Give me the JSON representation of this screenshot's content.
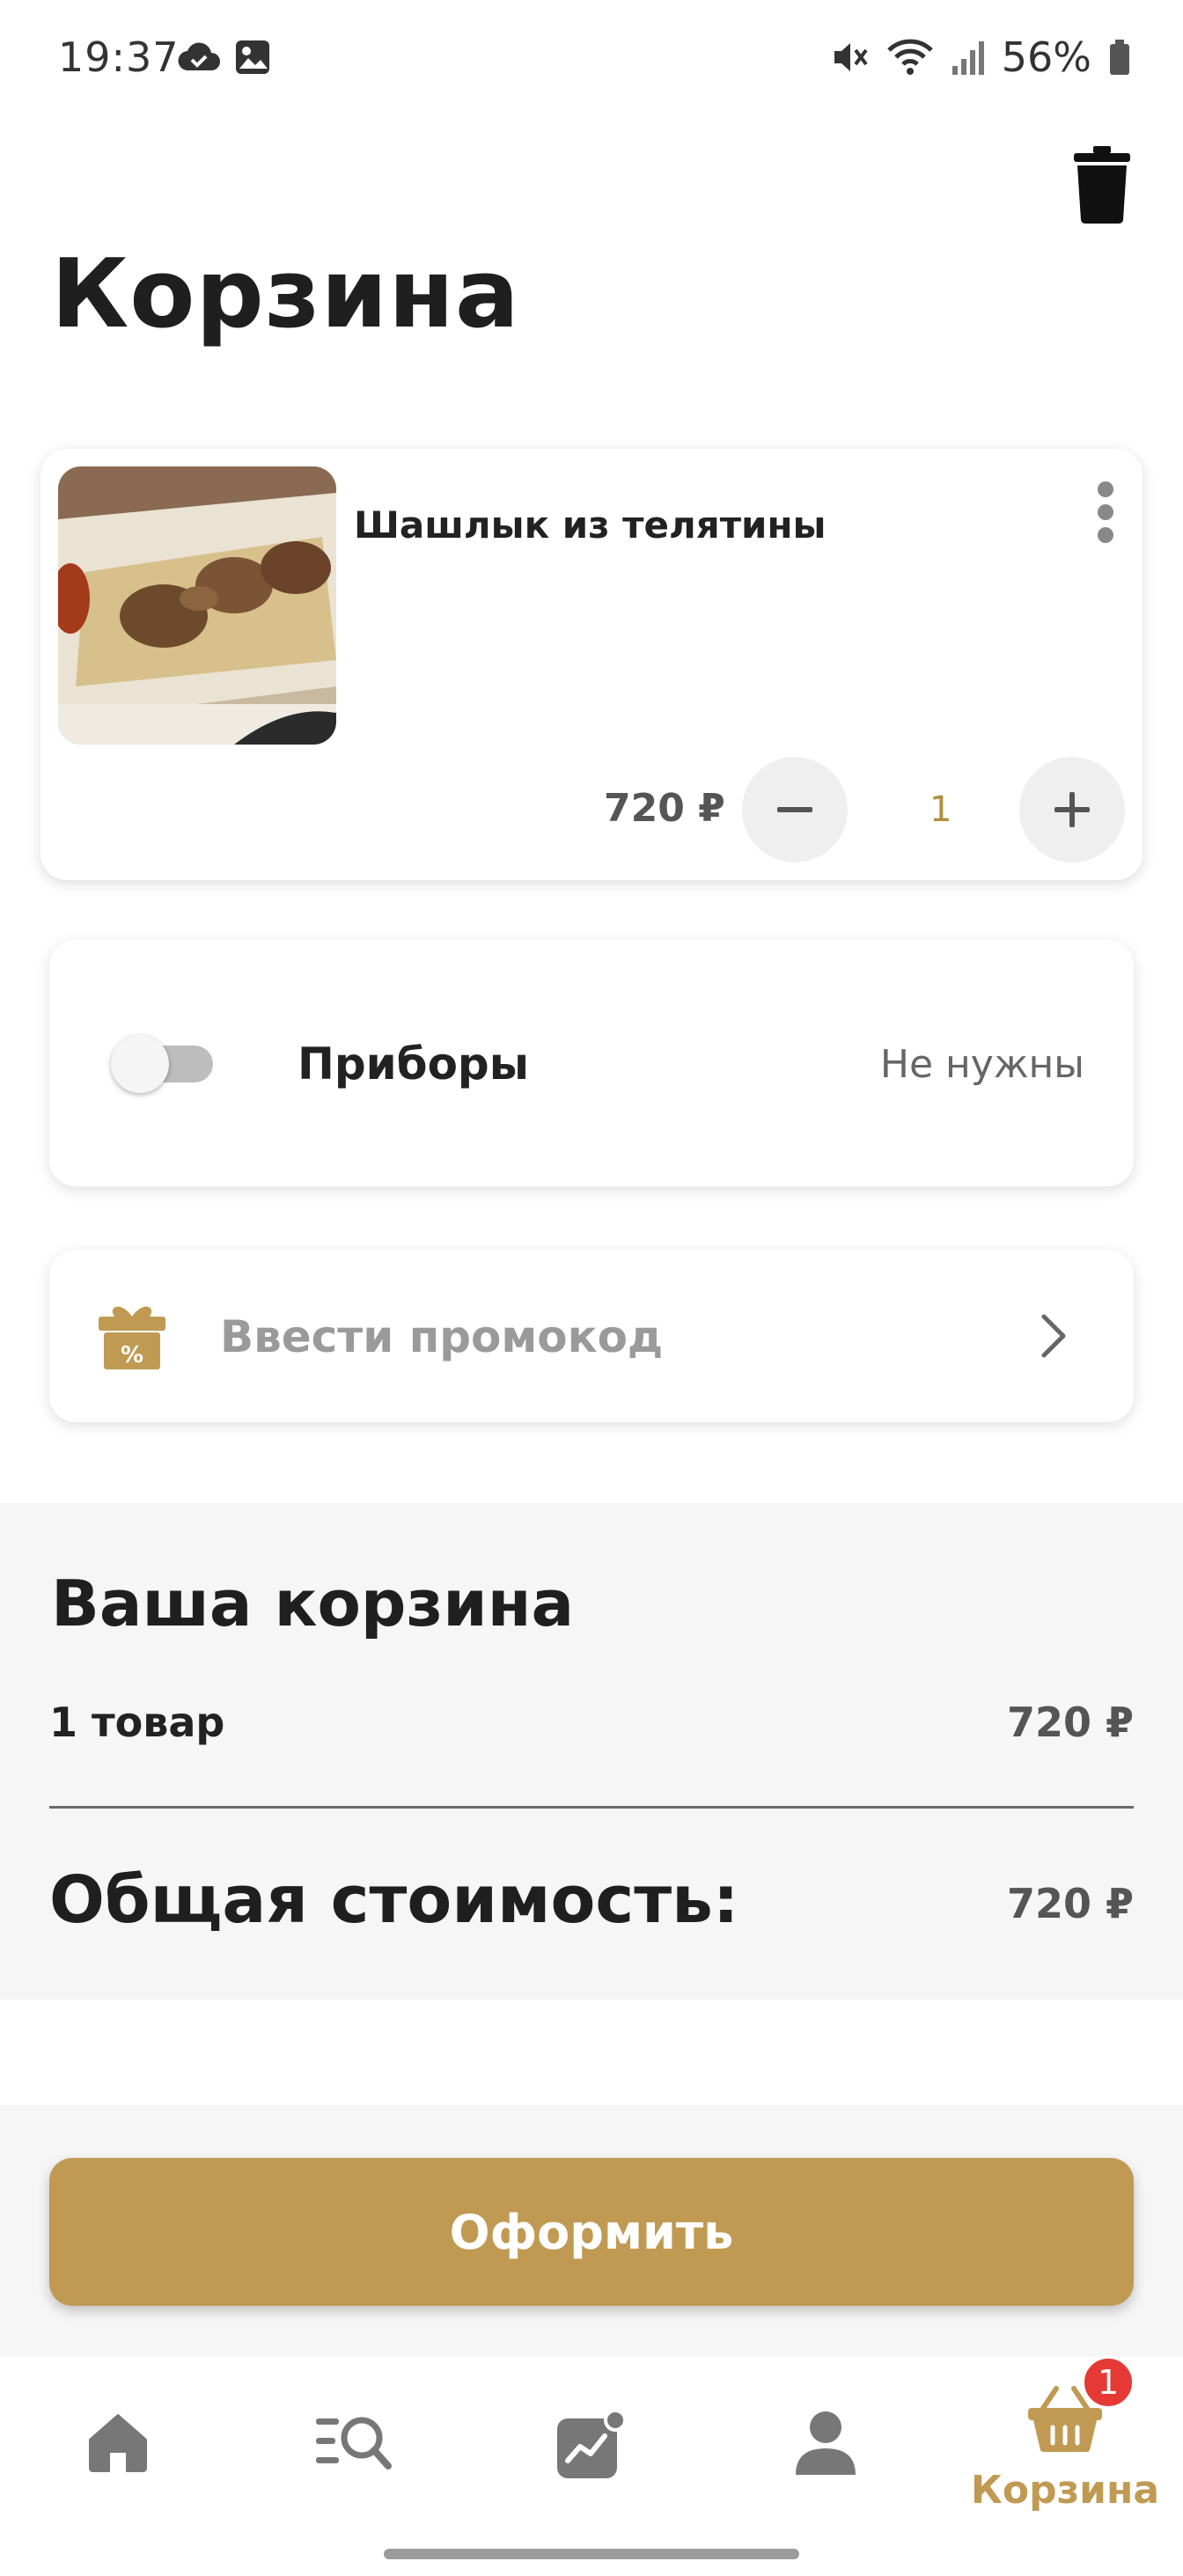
{
  "status_bar": {
    "time": "19:37",
    "battery": "56%",
    "icons_left": [
      "cloud-check-icon",
      "image-icon"
    ],
    "icons_right": [
      "mute-icon",
      "wifi-icon",
      "signal-icon",
      "battery-icon"
    ]
  },
  "header": {
    "title": "Корзина",
    "delete_icon": "trash-icon"
  },
  "cart_item": {
    "name": "Шашлык из телятины",
    "price": "720 ₽",
    "quantity": "1",
    "image_alt": "food-photo"
  },
  "cutlery": {
    "label": "Приборы",
    "status": "Не нужны",
    "enabled": false
  },
  "promo": {
    "placeholder": "Ввести промокод"
  },
  "summary": {
    "title": "Ваша корзина",
    "count_label": "1 товар",
    "subtotal": "720 ₽",
    "total_label": "Общая стоимость:",
    "total_value": "720 ₽"
  },
  "checkout": {
    "label": "Оформить"
  },
  "bottom_nav": {
    "items": [
      {
        "icon": "home-icon"
      },
      {
        "icon": "menu-search-icon"
      },
      {
        "icon": "chart-notification-icon"
      },
      {
        "icon": "profile-icon"
      },
      {
        "icon": "basket-icon",
        "label": "Корзина",
        "active": true,
        "badge": "1"
      }
    ]
  },
  "colors": {
    "accent": "#c09a52",
    "badge": "#e53935",
    "summary_bg": "#f6f6f6"
  }
}
